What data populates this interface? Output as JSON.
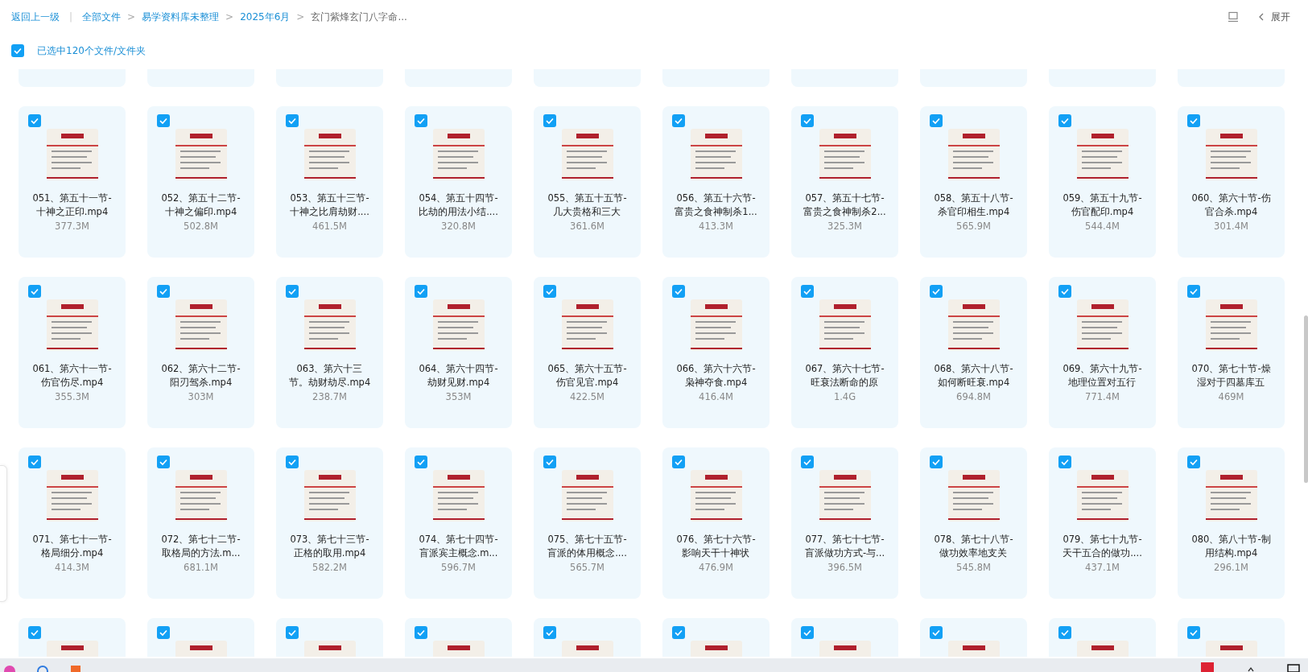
{
  "breadcrumb": {
    "back": "返回上一级",
    "path": [
      {
        "label": "全部文件",
        "current": false
      },
      {
        "label": "易学资料库未整理",
        "current": false
      },
      {
        "label": "2025年6月",
        "current": false
      },
      {
        "label": "玄门紫烽玄门八字命...",
        "current": true
      }
    ],
    "separator": ">",
    "divider": "|"
  },
  "toolbar": {
    "expand": "展开"
  },
  "selection": {
    "checked": true,
    "label": "已选中120个文件/文件夹"
  },
  "files": [
    {
      "name": [
        "051、第五十一节-",
        "十神之正印.mp4"
      ],
      "size": "377.3M",
      "selected": true
    },
    {
      "name": [
        "052、第五十二节-",
        "十神之偏印.mp4"
      ],
      "size": "502.8M",
      "selected": true
    },
    {
      "name": [
        "053、第五十三节-",
        "十神之比肩劫财...."
      ],
      "size": "461.5M",
      "selected": true
    },
    {
      "name": [
        "054、第五十四节-",
        "比劫的用法小结...."
      ],
      "size": "320.8M",
      "selected": true
    },
    {
      "name": [
        "055、第五十五节-",
        "几大贵格和三大"
      ],
      "size": "361.6M",
      "selected": true
    },
    {
      "name": [
        "056、第五十六节-",
        "富贵之食神制杀1..."
      ],
      "size": "413.3M",
      "selected": true
    },
    {
      "name": [
        "057、第五十七节-",
        "富贵之食神制杀2..."
      ],
      "size": "325.3M",
      "selected": true
    },
    {
      "name": [
        "058、第五十八节-",
        "杀官印相生.mp4"
      ],
      "size": "565.9M",
      "selected": true
    },
    {
      "name": [
        "059、第五十九节-",
        "伤官配印.mp4"
      ],
      "size": "544.4M",
      "selected": true
    },
    {
      "name": [
        "060、第六十节-伤",
        "官合杀.mp4"
      ],
      "size": "301.4M",
      "selected": true
    },
    {
      "name": [
        "061、第六十一节-",
        "伤官伤尽.mp4"
      ],
      "size": "355.3M",
      "selected": true
    },
    {
      "name": [
        "062、第六十二节-",
        "阳刃驾杀.mp4"
      ],
      "size": "303M",
      "selected": true
    },
    {
      "name": [
        "063、第六十三",
        "节。劫财劫尽.mp4"
      ],
      "size": "238.7M",
      "selected": true
    },
    {
      "name": [
        "064、第六十四节-",
        "劫财见财.mp4"
      ],
      "size": "353M",
      "selected": true
    },
    {
      "name": [
        "065、第六十五节-",
        "伤官见官.mp4"
      ],
      "size": "422.5M",
      "selected": true
    },
    {
      "name": [
        "066、第六十六节-",
        "枭神夺食.mp4"
      ],
      "size": "416.4M",
      "selected": true
    },
    {
      "name": [
        "067、第六十七节-",
        "旺衰法断命的原"
      ],
      "size": "1.4G",
      "selected": true
    },
    {
      "name": [
        "068、第六十八节-",
        "如何断旺衰.mp4"
      ],
      "size": "694.8M",
      "selected": true
    },
    {
      "name": [
        "069、第六十九节-",
        "地理位置对五行"
      ],
      "size": "771.4M",
      "selected": true
    },
    {
      "name": [
        "070、第七十节-燥",
        "湿对于四墓库五"
      ],
      "size": "469M",
      "selected": true
    },
    {
      "name": [
        "071、第七十一节-",
        "格局细分.mp4"
      ],
      "size": "414.3M",
      "selected": true
    },
    {
      "name": [
        "072、第七十二节-",
        "取格局的方法.m..."
      ],
      "size": "681.1M",
      "selected": true
    },
    {
      "name": [
        "073、第七十三节-",
        "正格的取用.mp4"
      ],
      "size": "582.2M",
      "selected": true
    },
    {
      "name": [
        "074、第七十四节-",
        "盲派宾主概念.m..."
      ],
      "size": "596.7M",
      "selected": true
    },
    {
      "name": [
        "075、第七十五节-",
        "盲派的体用概念...."
      ],
      "size": "565.7M",
      "selected": true
    },
    {
      "name": [
        "076、第七十六节-",
        "影响天干十神状"
      ],
      "size": "476.9M",
      "selected": true
    },
    {
      "name": [
        "077、第七十七节-",
        "盲派做功方式-与..."
      ],
      "size": "396.5M",
      "selected": true
    },
    {
      "name": [
        "078、第七十八节-",
        "做功效率地支关"
      ],
      "size": "545.8M",
      "selected": true
    },
    {
      "name": [
        "079、第七十九节-",
        "天干五合的做功...."
      ],
      "size": "437.1M",
      "selected": true
    },
    {
      "name": [
        "080、第八十节-制",
        "用结构.mp4"
      ],
      "size": "296.1M",
      "selected": true
    }
  ],
  "next_row": [
    {
      "selected": true
    },
    {
      "selected": true
    },
    {
      "selected": true
    },
    {
      "selected": true
    },
    {
      "selected": true
    },
    {
      "selected": true
    },
    {
      "selected": true
    },
    {
      "selected": true
    },
    {
      "selected": true
    },
    {
      "selected": true
    }
  ]
}
